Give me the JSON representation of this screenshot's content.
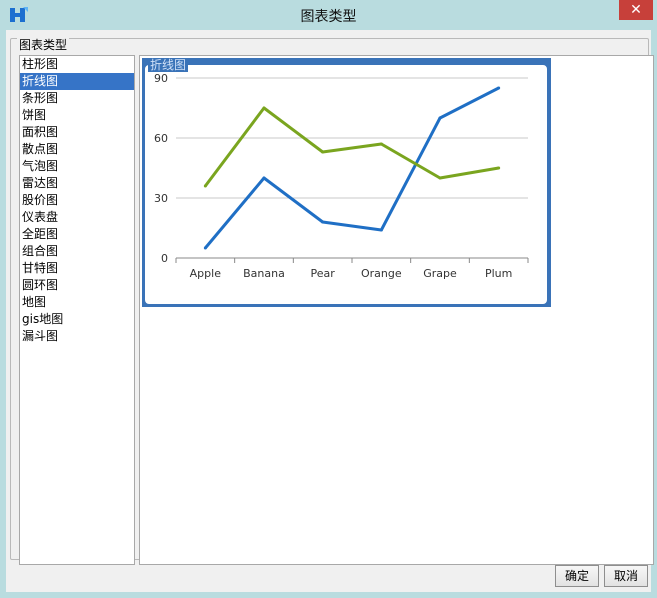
{
  "window": {
    "title": "图表类型",
    "close_label": "✕"
  },
  "group": {
    "title": "图表类型"
  },
  "chart_types": [
    {
      "label": "柱形图",
      "selected": false
    },
    {
      "label": "折线图",
      "selected": true
    },
    {
      "label": "条形图",
      "selected": false
    },
    {
      "label": "饼图",
      "selected": false
    },
    {
      "label": "面积图",
      "selected": false
    },
    {
      "label": "散点图",
      "selected": false
    },
    {
      "label": "气泡图",
      "selected": false
    },
    {
      "label": "雷达图",
      "selected": false
    },
    {
      "label": "股价图",
      "selected": false
    },
    {
      "label": "仪表盘",
      "selected": false
    },
    {
      "label": "全距图",
      "selected": false
    },
    {
      "label": "组合图",
      "selected": false
    },
    {
      "label": "甘特图",
      "selected": false
    },
    {
      "label": "圆环图",
      "selected": false
    },
    {
      "label": "地图",
      "selected": false
    },
    {
      "label": "gis地图",
      "selected": false
    },
    {
      "label": "漏斗图",
      "selected": false
    }
  ],
  "preview": {
    "label": "折线图"
  },
  "chart_data": {
    "type": "line",
    "title": "",
    "categories": [
      "Apple",
      "Banana",
      "Pear",
      "Orange",
      "Grape",
      "Plum"
    ],
    "series": [
      {
        "values": [
          5,
          40,
          18,
          14,
          70,
          85
        ],
        "color": "#1f6fc5"
      },
      {
        "values": [
          36,
          75,
          53,
          57,
          40,
          45
        ],
        "color": "#7aa51f"
      }
    ],
    "yticks": [
      0,
      30,
      60,
      90
    ],
    "ylim": [
      0,
      90
    ],
    "grid": true
  },
  "buttons": {
    "ok": "确定",
    "cancel": "取消"
  }
}
